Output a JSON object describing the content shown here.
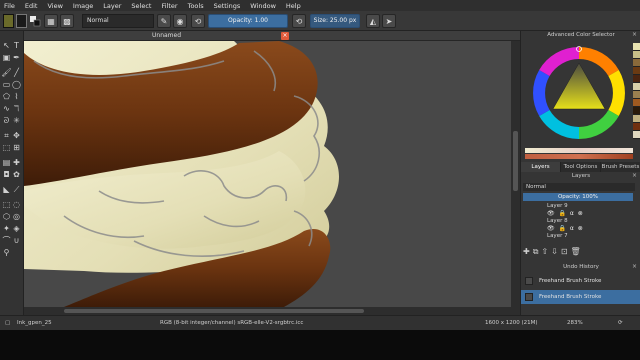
{
  "menu": [
    "File",
    "Edit",
    "View",
    "Image",
    "Layer",
    "Select",
    "Filter",
    "Tools",
    "Settings",
    "Window",
    "Help"
  ],
  "toolbar": {
    "blend_mode": "Normal",
    "opacity_label": "Opacity: 1.00",
    "size_label": "Size: 25.00 px"
  },
  "document": {
    "title": "Unnamed"
  },
  "color_selector": {
    "title": "Advanced Color Selector",
    "palette": [
      "#e8e2b0",
      "#c8c088",
      "#8a6a3a",
      "#6a3a12",
      "#4a2410",
      "#d8d0a8",
      "#9a8050",
      "#a05a20",
      "#2a1a0a",
      "#c0b080",
      "#703010",
      "#e0d8c0"
    ]
  },
  "dock_tabs": [
    "Layers",
    "Tool Options",
    "Brush Presets"
  ],
  "layers": {
    "title": "Layers",
    "blend_mode": "Normal",
    "opacity_label": "Opacity:  100%",
    "items": [
      {
        "name": "Layer 9"
      },
      {
        "name": "Layer 8"
      },
      {
        "name": "Layer 7"
      }
    ]
  },
  "undo_history": {
    "title": "Undo History",
    "items": [
      "Freehand Brush Stroke",
      "Freehand Brush Stroke"
    ]
  },
  "status": {
    "brush": "Ink_gpen_25",
    "color_info": "RGB (8-bit integer/channel)  sRGB-elle-V2-srgbtrc.icc",
    "dimensions": "1600 x 1200 (21M)",
    "zoom": "283%"
  }
}
